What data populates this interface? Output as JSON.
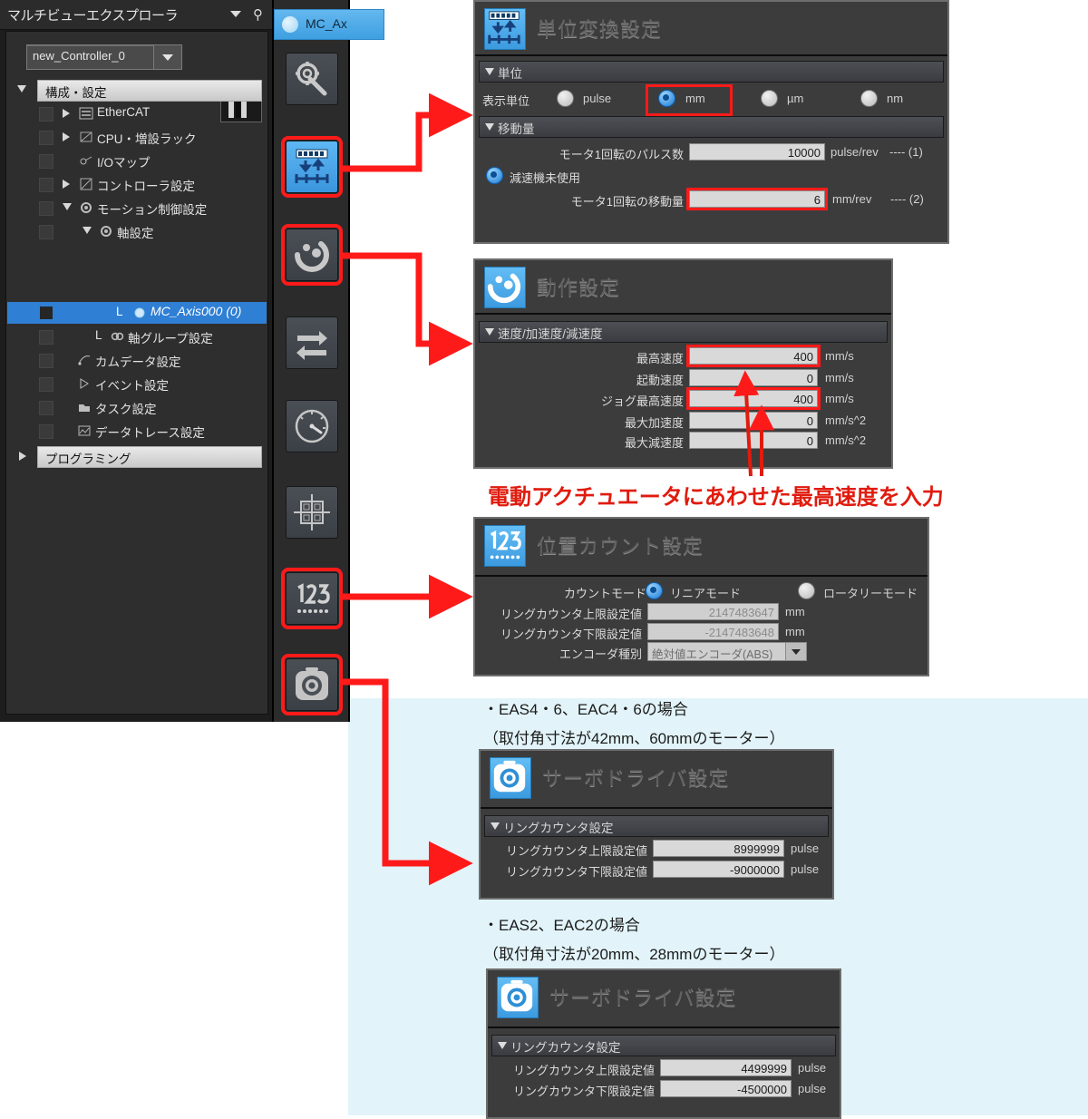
{
  "explorer": {
    "title": "マルチビューエクスプローラ",
    "caret_icon": "chevron-down-icon",
    "pin_icon": "pin-icon",
    "controller": {
      "value": "new_Controller_0"
    },
    "tree": [
      {
        "label": "構成・設定",
        "type": "header",
        "state": "open"
      },
      {
        "label": "EtherCAT",
        "type": "node",
        "state": "closed",
        "icon": "ethercat-icon"
      },
      {
        "label": "CPU・増設ラック",
        "type": "node",
        "state": "closed",
        "icon": "rack-icon"
      },
      {
        "label": "I/Oマップ",
        "type": "leaf",
        "icon": "iomap-icon"
      },
      {
        "label": "コントローラ設定",
        "type": "node",
        "state": "closed",
        "icon": "controller-icon"
      },
      {
        "label": "モーション制御設定",
        "type": "node",
        "state": "open",
        "icon": "motion-icon"
      },
      {
        "label": "軸設定",
        "type": "node",
        "state": "open",
        "icon": "axis-icon"
      },
      {
        "label": "MC_Axis000 (0)",
        "type": "leaf-selected",
        "icon": "axis-item-icon"
      },
      {
        "label": "軸グループ設定",
        "type": "leaf",
        "icon": "axisgroup-icon"
      },
      {
        "label": "カムデータ設定",
        "type": "leaf",
        "icon": "cam-icon"
      },
      {
        "label": "イベント設定",
        "type": "leaf",
        "icon": "event-icon"
      },
      {
        "label": "タスク設定",
        "type": "leaf",
        "icon": "task-icon"
      },
      {
        "label": "データトレース設定",
        "type": "leaf",
        "icon": "datatrace-icon"
      },
      {
        "label": "プログラミング",
        "type": "header",
        "state": "closed"
      }
    ]
  },
  "tab": {
    "label": "MC_Ax",
    "icon": "axis-tab-icon"
  },
  "toolbar": {
    "items": [
      {
        "name": "gear-wrench-icon",
        "highlighted": false,
        "active": false
      },
      {
        "name": "unit-conversion-icon",
        "highlighted": true,
        "active": true
      },
      {
        "name": "operation-settings-icon",
        "highlighted": true,
        "active": false
      },
      {
        "name": "swap-arrows-icon",
        "highlighted": false,
        "active": false
      },
      {
        "name": "gauge-icon",
        "highlighted": false,
        "active": false
      },
      {
        "name": "crosshair-grid-icon",
        "highlighted": false,
        "active": false
      },
      {
        "name": "position-count-icon",
        "highlighted": true,
        "active": false
      },
      {
        "name": "servo-driver-icon",
        "highlighted": true,
        "active": false
      }
    ]
  },
  "unit_panel": {
    "title": "単位変換設定",
    "icon": "unit-conversion-icon",
    "group_unit": "単位",
    "display_unit_label": "表示単位",
    "options": [
      {
        "label": "pulse",
        "selected": false,
        "boxed": false
      },
      {
        "label": "mm",
        "selected": true,
        "boxed": true
      },
      {
        "label": "µm",
        "selected": false,
        "boxed": false
      },
      {
        "label": "nm",
        "selected": false,
        "boxed": false
      }
    ],
    "group_travel": "移動量",
    "pulses_label": "モータ1回転のパルス数",
    "pulses_value": "10000",
    "pulses_unit": "pulse/rev",
    "pulses_ref": "---- (1)",
    "no_gear_label": "減速機未使用",
    "travel_label": "モータ1回転の移動量",
    "travel_value": "6",
    "travel_unit": "mm/rev",
    "travel_ref": "---- (2)"
  },
  "operation_panel": {
    "title": "動作設定",
    "icon": "operation-settings-icon",
    "group": "速度/加速度/減速度",
    "rows": [
      {
        "label": "最高速度",
        "value": "400",
        "unit": "mm/s",
        "boxed": true
      },
      {
        "label": "起動速度",
        "value": "0",
        "unit": "mm/s",
        "boxed": false
      },
      {
        "label": "ジョグ最高速度",
        "value": "400",
        "unit": "mm/s",
        "boxed": true
      },
      {
        "label": "最大加速度",
        "value": "0",
        "unit": "mm/s^2",
        "boxed": false
      },
      {
        "label": "最大減速度",
        "value": "0",
        "unit": "mm/s^2",
        "boxed": false
      }
    ]
  },
  "callout": {
    "text": "電動アクチュエータにあわせた最高速度を入力",
    "color": "#e01b0e"
  },
  "count_panel": {
    "title": "位置カウント設定",
    "icon": "position-count-icon",
    "count_mode_label": "カウントモード",
    "modes": [
      {
        "label": "リニアモード",
        "selected": true
      },
      {
        "label": "ロータリーモード",
        "selected": false
      }
    ],
    "rows": [
      {
        "label": "リングカウンタ上限設定値",
        "value": "2147483647",
        "unit": "mm"
      },
      {
        "label": "リングカウンタ下限設定値",
        "value": "-2147483648",
        "unit": "mm"
      }
    ],
    "encoder_label": "エンコーダ種別",
    "encoder_value": "絶対値エンコーダ(ABS)"
  },
  "note_1": {
    "line1": "・EAS4・6、EAC4・6の場合",
    "line2": "（取付角寸法が42mm、60mmのモーター）"
  },
  "servo_panel_1": {
    "title": "サーボドライバ設定",
    "icon": "servo-driver-icon",
    "group": "リングカウンタ設定",
    "rows": [
      {
        "label": "リングカウンタ上限設定値",
        "value": "8999999",
        "unit": "pulse"
      },
      {
        "label": "リングカウンタ下限設定値",
        "value": "-9000000",
        "unit": "pulse"
      }
    ]
  },
  "note_2": {
    "line1": "・EAS2、EAC2の場合",
    "line2": "（取付角寸法が20mm、28mmのモーター）"
  },
  "servo_panel_2": {
    "title": "サーボドライバ設定",
    "icon": "servo-driver-icon",
    "group": "リングカウンタ設定",
    "rows": [
      {
        "label": "リングカウンタ上限設定値",
        "value": "4499999",
        "unit": "pulse"
      },
      {
        "label": "リングカウンタ下限設定値",
        "value": "-4500000",
        "unit": "pulse"
      }
    ]
  },
  "colors": {
    "highlight_red": "#ff1a1a",
    "selection_blue": "#2f7fd4",
    "panel_bg": "#3c3c3c",
    "cyan_bg": "#e2f4f9",
    "annotation_red": "#e01b0e"
  }
}
